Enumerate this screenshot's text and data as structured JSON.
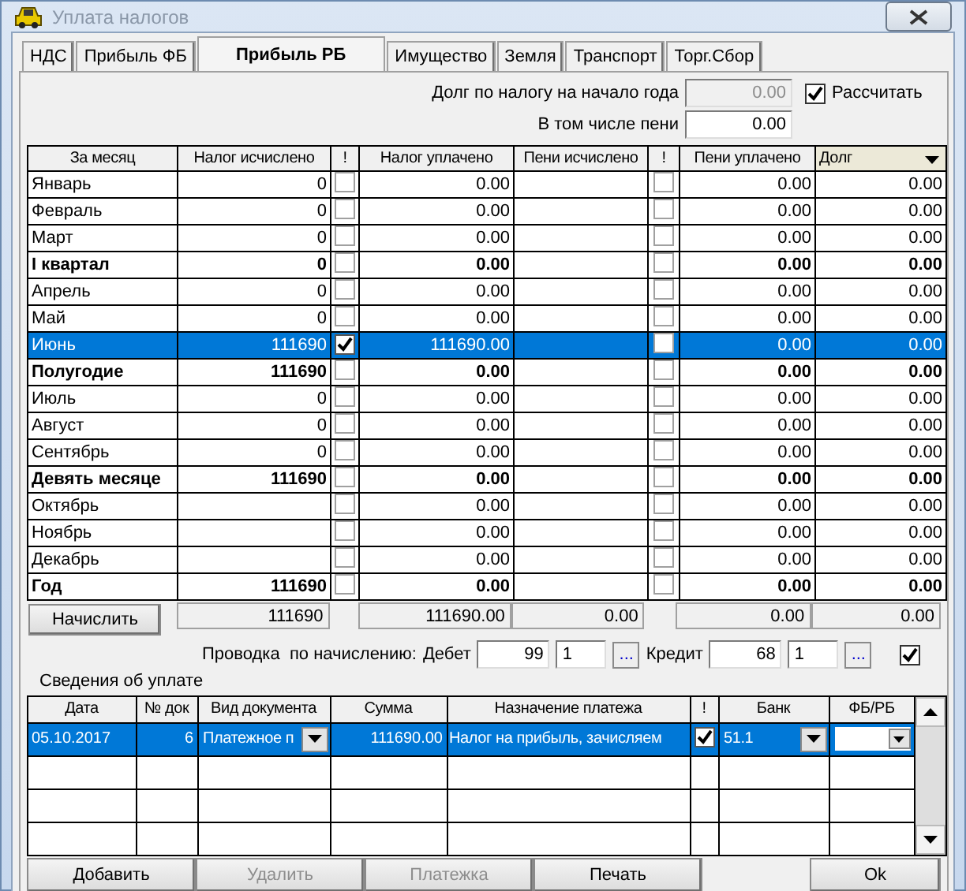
{
  "window": {
    "title": "Уплата налогов"
  },
  "tabs": [
    {
      "label": "НДС",
      "selected": false
    },
    {
      "label": "Прибыль ФБ",
      "selected": false
    },
    {
      "label": "Прибыль РБ",
      "selected": true
    },
    {
      "label": "Имущество",
      "selected": false
    },
    {
      "label": "Земля",
      "selected": false
    },
    {
      "label": "Транспорт",
      "selected": false
    },
    {
      "label": "Торг.Сбор",
      "selected": false
    }
  ],
  "debt_start": {
    "label": "Долг по налогу на начало года",
    "value": "0.00",
    "disabled": true
  },
  "recalc": {
    "label": "Рассчитать",
    "checked": true
  },
  "penalty_included": {
    "label": "В том числе пени",
    "value": "0.00",
    "disabled": false
  },
  "table": {
    "columns": [
      "За месяц",
      "Налог исчислено",
      "!",
      "Налог уплачено",
      "Пени исчислено",
      "!",
      "Пени уплачено",
      "Долг"
    ],
    "rows": [
      {
        "kind": "month",
        "name": "Январь",
        "tax": "0",
        "tax_flag": false,
        "tax_paid": "0.00",
        "penalty_flag": false,
        "penalty_paid": "0.00",
        "debt": "0.00",
        "selected": false
      },
      {
        "kind": "month",
        "name": "Февраль",
        "tax": "0",
        "tax_flag": false,
        "tax_paid": "0.00",
        "penalty_flag": false,
        "penalty_paid": "0.00",
        "debt": "0.00",
        "selected": false
      },
      {
        "kind": "month",
        "name": "Март",
        "tax": "0",
        "tax_flag": false,
        "tax_paid": "0.00",
        "penalty_flag": false,
        "penalty_paid": "0.00",
        "debt": "0.00",
        "selected": false
      },
      {
        "kind": "total",
        "name": "I квартал",
        "tax": "0",
        "tax_flag": false,
        "tax_paid": "0.00",
        "penalty_flag": false,
        "penalty_paid": "0.00",
        "debt": "0.00",
        "selected": false
      },
      {
        "kind": "month",
        "name": "Апрель",
        "tax": "0",
        "tax_flag": false,
        "tax_paid": "0.00",
        "penalty_flag": false,
        "penalty_paid": "0.00",
        "debt": "0.00",
        "selected": false
      },
      {
        "kind": "month",
        "name": "Май",
        "tax": "0",
        "tax_flag": false,
        "tax_paid": "0.00",
        "penalty_flag": false,
        "penalty_paid": "0.00",
        "debt": "0.00",
        "selected": false
      },
      {
        "kind": "month",
        "name": "Июнь",
        "tax": "111690",
        "tax_flag": true,
        "tax_paid": "111690.00",
        "penalty_flag": false,
        "penalty_paid": "0.00",
        "debt": "0.00",
        "selected": true
      },
      {
        "kind": "total",
        "name": "Полугодие",
        "tax": "111690",
        "tax_flag": false,
        "tax_paid": "0.00",
        "penalty_flag": false,
        "penalty_paid": "0.00",
        "debt": "0.00",
        "selected": false
      },
      {
        "kind": "month",
        "name": "Июль",
        "tax": "0",
        "tax_flag": false,
        "tax_paid": "0.00",
        "penalty_flag": false,
        "penalty_paid": "0.00",
        "debt": "0.00",
        "selected": false
      },
      {
        "kind": "month",
        "name": "Август",
        "tax": "0",
        "tax_flag": false,
        "tax_paid": "0.00",
        "penalty_flag": false,
        "penalty_paid": "0.00",
        "debt": "0.00",
        "selected": false
      },
      {
        "kind": "month",
        "name": "Сентябрь",
        "tax": "0",
        "tax_flag": false,
        "tax_paid": "0.00",
        "penalty_flag": false,
        "penalty_paid": "0.00",
        "debt": "0.00",
        "selected": false
      },
      {
        "kind": "total",
        "name": "Девять месяце",
        "tax": "111690",
        "tax_flag": false,
        "tax_paid": "0.00",
        "penalty_flag": false,
        "penalty_paid": "0.00",
        "debt": "0.00",
        "selected": false
      },
      {
        "kind": "month",
        "name": "Октябрь",
        "tax_flag": false,
        "tax_paid": "0.00",
        "penalty_flag": false,
        "penalty_paid": "0.00",
        "debt": "0.00",
        "selected": false
      },
      {
        "kind": "month",
        "name": "Ноябрь",
        "tax_flag": false,
        "tax_paid": "0.00",
        "penalty_flag": false,
        "penalty_paid": "0.00",
        "debt": "0.00",
        "selected": false
      },
      {
        "kind": "month",
        "name": "Декабрь",
        "tax_flag": false,
        "tax_paid": "0.00",
        "penalty_flag": false,
        "penalty_paid": "0.00",
        "debt": "0.00",
        "selected": false
      },
      {
        "kind": "total",
        "name": "Год",
        "tax": "111690",
        "tax_flag": false,
        "tax_paid": "0.00",
        "penalty_flag": false,
        "penalty_paid": "0.00",
        "debt": "0.00",
        "selected": false
      }
    ],
    "totals": {
      "tax": "111690",
      "tax_paid": "111690.00",
      "penalty": "0.00",
      "penalty_paid": "0.00",
      "debt": "0.00"
    }
  },
  "calc_button": "Начислить",
  "posting": {
    "label": "Проводка  по начислению:",
    "debit_label": "Дебет",
    "debit": "99",
    "debit_sub": "1",
    "debit_browse": "...",
    "credit_label": "Кредит",
    "credit": "68",
    "credit_sub": "1",
    "credit_browse": "...",
    "checked": true
  },
  "payments": {
    "title": "Сведения об уплате",
    "columns": [
      "Дата",
      "№ док",
      "Вид документа",
      "Сумма",
      "Назначение платежа",
      "!",
      "Банк",
      "ФБ/РБ"
    ],
    "rows": [
      {
        "date": "05.10.2017",
        "number": "6",
        "doc_type": "Платежное п",
        "amount": "111690.00",
        "purpose": "Налог на прибыль, зачисляем",
        "flag": true,
        "bank": "51.1",
        "selected": true
      }
    ]
  },
  "buttons": [
    {
      "label": "Добавить",
      "disabled": false
    },
    {
      "label": "Удалить",
      "disabled": true
    },
    {
      "label": "Платежка",
      "disabled": true
    },
    {
      "label": "Печать",
      "disabled": false
    }
  ],
  "ok_button": "Ok"
}
